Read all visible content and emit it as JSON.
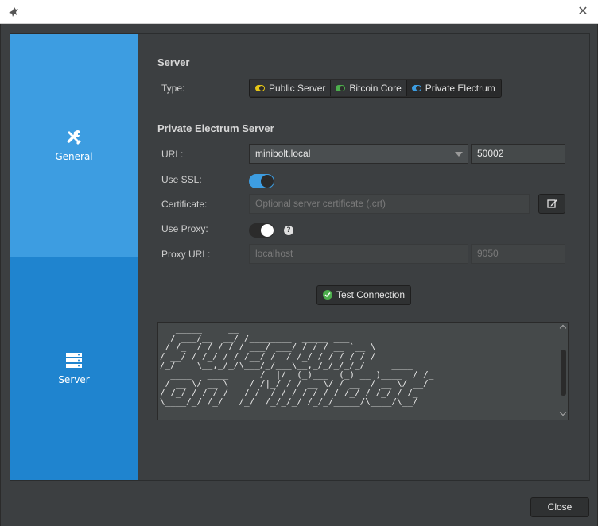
{
  "window": {
    "close_glyph": "✕"
  },
  "sidebar": {
    "items": [
      {
        "label": "General",
        "icon": "tools-icon"
      },
      {
        "label": "Server",
        "icon": "server-icon"
      }
    ]
  },
  "server_section": {
    "title": "Server",
    "type_label": "Type:",
    "type_options": [
      {
        "label": "Public Server",
        "color": "#e5c617"
      },
      {
        "label": "Bitcoin Core",
        "color": "#4cae4c"
      },
      {
        "label": "Private Electrum",
        "color": "#3d9de1"
      }
    ],
    "selected_type": "Private Electrum"
  },
  "private_electrum": {
    "title": "Private Electrum Server",
    "url_label": "URL:",
    "url_value": "minibolt.local",
    "port_value": "50002",
    "use_ssl_label": "Use SSL:",
    "use_ssl": true,
    "certificate_label": "Certificate:",
    "certificate_placeholder": "Optional server certificate (.crt)",
    "use_proxy_label": "Use Proxy:",
    "use_proxy": false,
    "help_glyph": "?",
    "proxy_url_label": "Proxy URL:",
    "proxy_host_placeholder": "localhost",
    "proxy_port_placeholder": "9050"
  },
  "test_connection": {
    "label": "Test Connection"
  },
  "log": {
    "text": "   _____     __\n  / ___/__  __/ /________  _____ ___\n / /_  / / / / / ___/ ___/ / / / __ `__ \\\n/ __/ / /_/ / / /__/ /  / /_/ / / / / / /\n/_/    \\__,_/_/\\___/_/___\\__,_/_/_/_/_/     ____\n  ____   ____      /  |/  (_)___  (_) __ )____  / /_\n / __ \\/ __ \\    / /|_/ / / __ \\/ / __  / __ \\/ __/\n/ /_/ / / / /   / /  / / / / / / / /_/ / /_/ / /_\n\\____/_/ /_/   /_/  /_/_/_/ /_/_/_____/\\____/\\__/"
  },
  "footer": {
    "close_label": "Close"
  }
}
